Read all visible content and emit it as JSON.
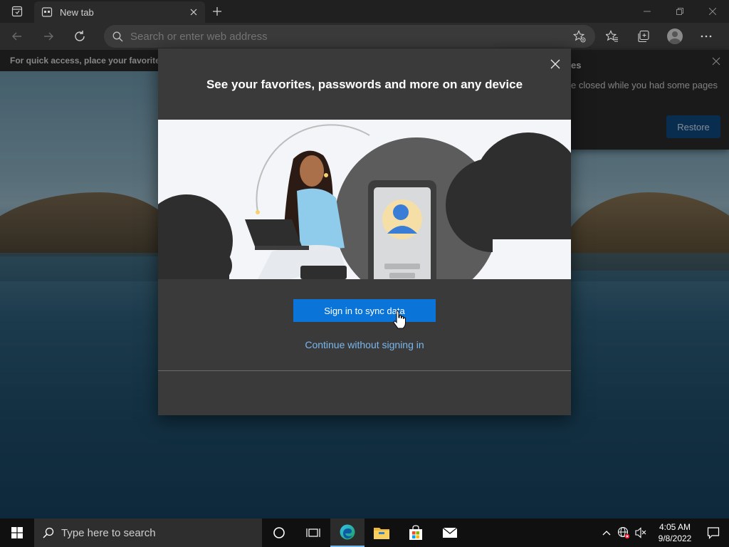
{
  "browser": {
    "tab": {
      "label": "New tab",
      "icon": "newtab-page-icon"
    },
    "address": {
      "placeholder": "Search or enter web address"
    },
    "favorites_bar": {
      "text": "For quick access, place your favorites here"
    }
  },
  "restore_panel": {
    "title": "es",
    "message": "e closed while you had some pages",
    "restore_label": "Restore"
  },
  "dialog": {
    "title": "See your favorites, passwords and more on any device",
    "primary_label": "Sign in to sync data",
    "secondary_label": "Continue without signing in"
  },
  "taskbar": {
    "search_placeholder": "Type here to search",
    "time": "4:05 AM",
    "date": "9/8/2022"
  },
  "colors": {
    "accent": "#0a74d8",
    "link": "#7ab7ee",
    "dialog_bg": "#3a3a3a"
  }
}
